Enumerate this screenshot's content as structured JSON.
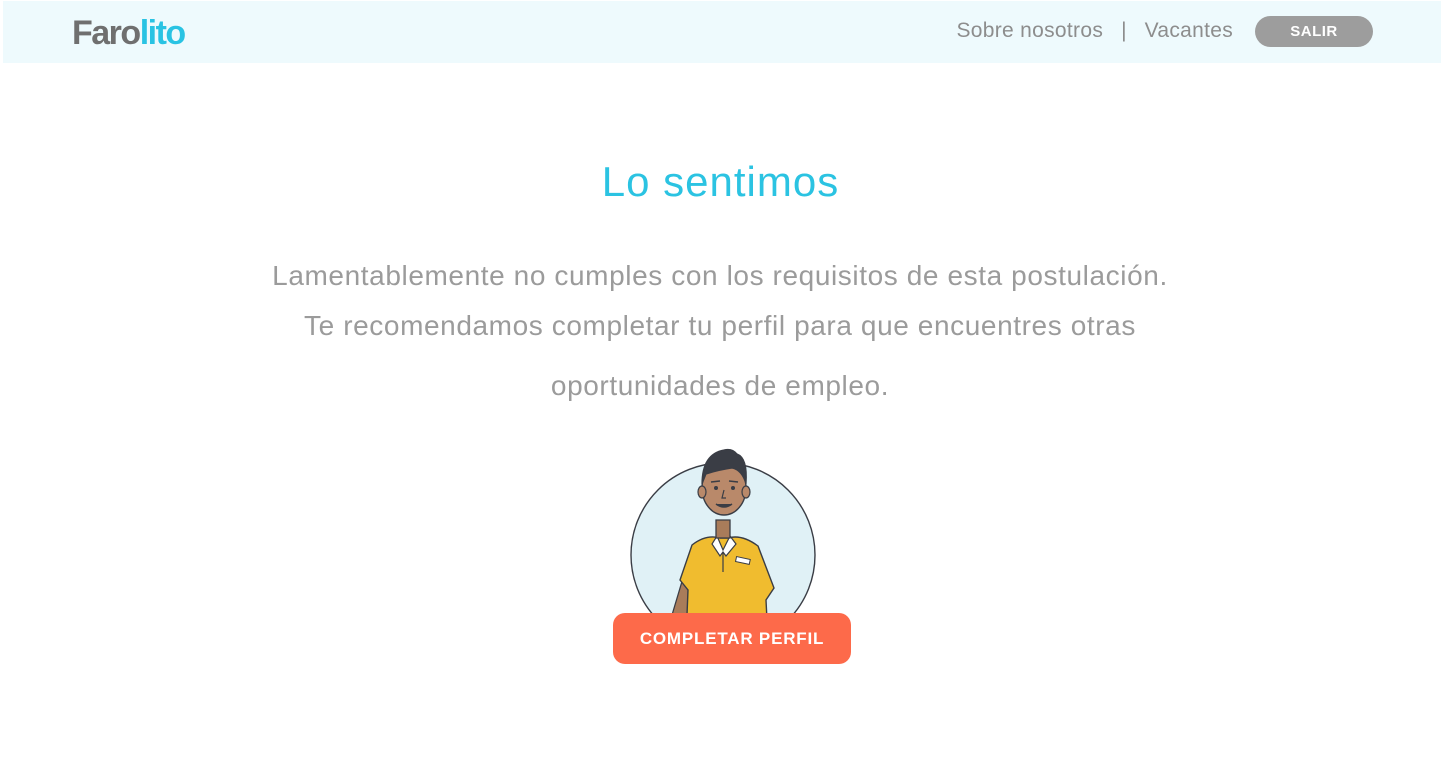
{
  "header": {
    "logo": {
      "part1": "Faro",
      "part2": "lito"
    },
    "nav": {
      "about": "Sobre nosotros",
      "separator": "|",
      "vacancies": "Vacantes"
    },
    "logout_label": "SALIR"
  },
  "main": {
    "title": "Lo sentimos",
    "message_line1": "Lamentablemente no cumples con los requisitos de esta postulación.",
    "message_line2": "Te recomendamos completar tu perfil para que encuentres otras",
    "message_line3": "oportunidades de empleo.",
    "cta_label": "COMPLETAR PERFIL"
  },
  "colors": {
    "header_bg": "#eefafd",
    "accent_blue": "#2bc3e2",
    "cta_orange": "#fd6a4a",
    "logout_grey": "#9d9d9d"
  }
}
